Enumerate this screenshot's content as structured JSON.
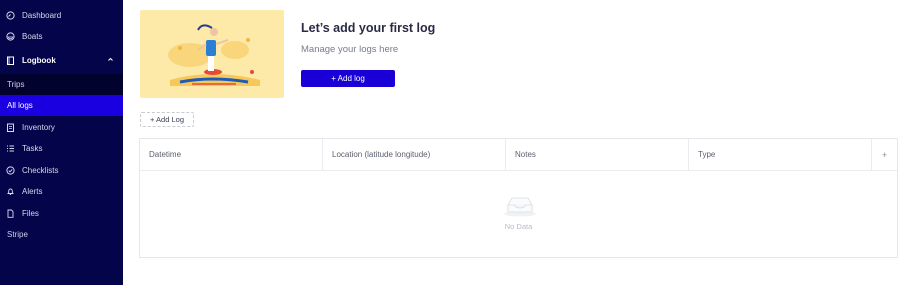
{
  "sidebar": {
    "items": [
      {
        "label": "Dashboard",
        "icon": "dashboard-icon"
      },
      {
        "label": "Boats",
        "icon": "boat-icon"
      },
      {
        "label": "Logbook",
        "icon": "logbook-icon"
      },
      {
        "label": "Trips"
      },
      {
        "label": "All logs"
      },
      {
        "label": "Inventory",
        "icon": "inventory-icon"
      },
      {
        "label": "Tasks",
        "icon": "tasks-icon"
      },
      {
        "label": "Checklists",
        "icon": "checklist-icon"
      },
      {
        "label": "Alerts",
        "icon": "bell-icon"
      },
      {
        "label": "Files",
        "icon": "file-icon"
      },
      {
        "label": "Stripe"
      }
    ],
    "active": "All logs"
  },
  "hero": {
    "title": "Let’s add your first log",
    "subtitle": "Manage your logs here",
    "add_button": "+ Add log"
  },
  "add_row_button": "+ Add Log",
  "table": {
    "columns": [
      "Datetime",
      "Location (latitude longitude)",
      "Notes",
      "Type",
      "+"
    ],
    "empty_text": "No Data"
  },
  "colors": {
    "sidebar_bg": "#04044a",
    "accent": "#1a00d6",
    "illustration_bg": "#fde9a8"
  }
}
